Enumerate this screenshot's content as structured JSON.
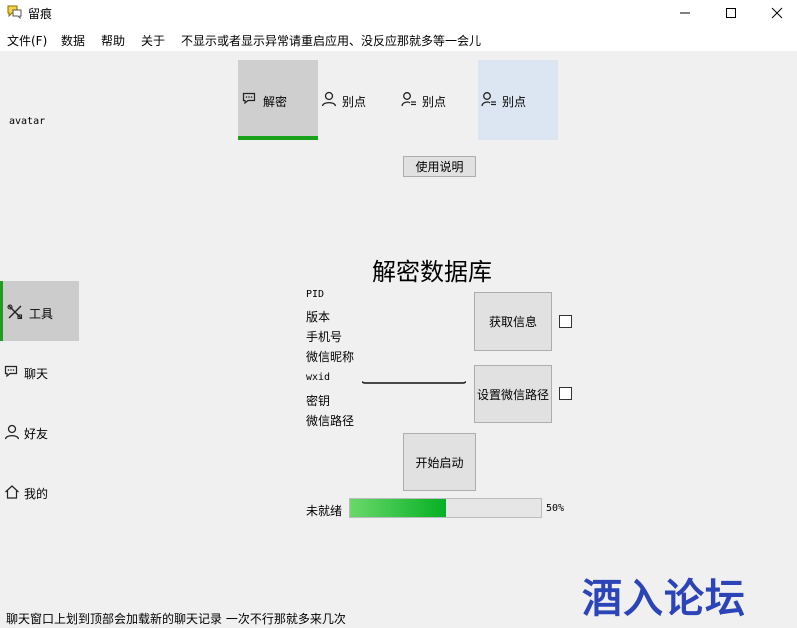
{
  "window": {
    "title": "留痕"
  },
  "menu": [
    "文件(F)",
    "数据",
    "帮助",
    "关于",
    "不显示或者显示异常请重启应用、没反应那就多等一会儿"
  ],
  "avatar_text": "avatar",
  "top_tabs": [
    {
      "label": "解密",
      "icon": "chat-bubble-icon",
      "selected": true
    },
    {
      "label": "别点",
      "icon": "person-icon"
    },
    {
      "label": "别点",
      "icon": "person-list-icon"
    },
    {
      "label": "别点",
      "icon": "person-list-icon",
      "hovered": true
    }
  ],
  "help_button": "使用说明",
  "sidebar": [
    {
      "label": "工具",
      "icon": "tools-icon",
      "selected": true
    },
    {
      "label": "聊天",
      "icon": "chat-bubble-icon"
    },
    {
      "label": "好友",
      "icon": "person-icon"
    },
    {
      "label": "我的",
      "icon": "home-icon"
    }
  ],
  "main": {
    "heading": "解密数据库",
    "info_labels": [
      "PID",
      "版本",
      "手机号",
      "微信昵称",
      "wxid",
      "密钥",
      "微信路径"
    ],
    "get_info_button": "获取信息",
    "set_path_button": "设置微信路径",
    "start_button": "开始启动",
    "status": "未就绪",
    "progress": 0.5,
    "progress_text": "50%"
  },
  "watermark": "酒入论坛",
  "statusbar": "聊天窗口上划到顶部会加载新的聊天记录 一次不行那就多来几次",
  "colors": {
    "accent": "#1aa11a",
    "progress": "#06b025",
    "hover_tab": "#dbe6f2",
    "watermark": "#2b44b8"
  }
}
